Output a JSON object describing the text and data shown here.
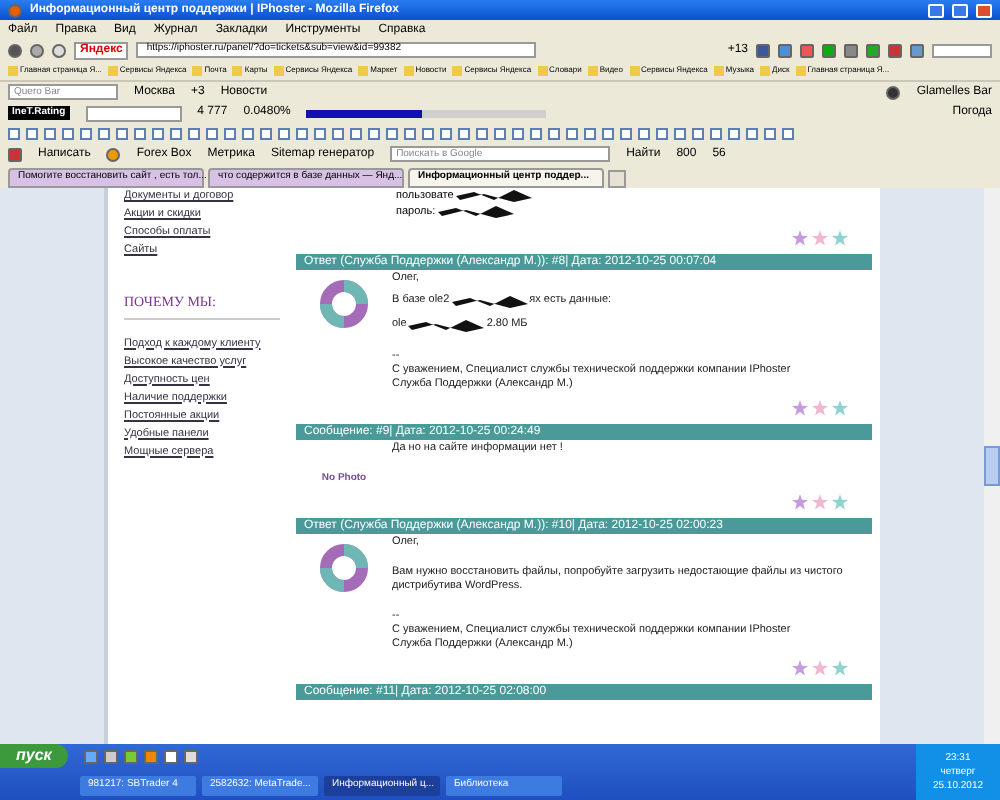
{
  "window": {
    "title": "Информационный центр поддержки | IPhoster - Mozilla Firefox"
  },
  "menu": [
    "Файл",
    "Правка",
    "Вид",
    "Журнал",
    "Закладки",
    "Инструменты",
    "Справка"
  ],
  "nav": {
    "brand": "Яндекс",
    "url": "https://iphoster.ru/panel/?do=tickets&sub=view&id=99382",
    "weather": "+13"
  },
  "bookmarks": [
    "Главная страница Я...",
    "Сервисы Яндекса",
    "Почта",
    "Карты",
    "Сервисы Яндекса",
    "Маркет",
    "Новости",
    "Сервисы Яндекса",
    "Словари",
    "Видео",
    "Сервисы Яндекса",
    "Музыка",
    "Диск",
    "Главная страница Я..."
  ],
  "yabar": {
    "placeholder": "Quero Bar",
    "city": "Москва",
    "temp": "+3",
    "news": "Новости",
    "right": "Glamelles Bar"
  },
  "stats": {
    "label": "IneT.Rating",
    "rank": "4 777",
    "percent": "0.0480%",
    "level": 0.48,
    "weather": "Погода"
  },
  "addons": {
    "write": "Написать",
    "forex": "Forex Box",
    "metrika": "Метрика",
    "sitemap": "Sitemap генератор",
    "placeholder": "Поискать в Google",
    "find": "Найти",
    "count1": "800",
    "count2": "56"
  },
  "tabs": [
    {
      "label": "Помогите восстановить сайт , есть тол...",
      "selected": false
    },
    {
      "label": "что содержится в базе данных — Янд...",
      "selected": false
    },
    {
      "label": "Информационный центр поддер...",
      "selected": true
    }
  ],
  "sidebar": {
    "links": [
      "Документы и договор",
      "Акции и скидки",
      "Способы оплаты",
      "Сайты"
    ],
    "heading": "ПОЧЕМУ МЫ:",
    "why": [
      "Подход к каждому клиенту",
      "Высокое качество услуг",
      "Доступность цен",
      "Наличие поддержки",
      "Постоянные акции",
      "Удобные панели",
      "Мощные сервера"
    ]
  },
  "top_lines": [
    "пользовате",
    "пароль:"
  ],
  "posts": [
    {
      "kind": "reply",
      "header": "Ответ (Служба Поддержки (Александр М.)): #8| Дата: 2012-10-25 00:07:04",
      "lines": [
        {
          "text": "Олег,"
        },
        {
          "text": "В базе ole2",
          "after": "ях есть данные:",
          "redacted": true
        },
        {
          "text": "ole",
          "after": "2.80 МБ",
          "redacted": true
        }
      ],
      "sign": [
        "--",
        "С уважением, Специалист службы технической поддержки компании IPhoster",
        "Служба Поддержки (Александр М.)"
      ]
    },
    {
      "kind": "message",
      "header": "Сообщение: #9| Дата: 2012-10-25 00:24:49",
      "lines": [
        {
          "text": "Да но на сайте информации нет !"
        }
      ],
      "photo": "No Photo"
    },
    {
      "kind": "reply",
      "header": "Ответ (Служба Поддержки (Александр М.)): #10| Дата: 2012-10-25 02:00:23",
      "lines": [
        {
          "text": "Олег,"
        },
        {
          "text": "Вам нужно восстановить файлы, попробуйте загрузить недостающие файлы из чистого дистрибутива WordPress."
        }
      ],
      "sign": [
        "--",
        "С уважением, Специалист службы технической поддержки компании IPhoster",
        "Служба Поддержки (Александр М.)"
      ]
    },
    {
      "kind": "header",
      "header": "Сообщение: #11| Дата: 2012-10-25 02:08:00"
    }
  ],
  "taskbar": {
    "start": "пуск",
    "items": [
      {
        "label": "981217: SBTrader 4",
        "selected": false
      },
      {
        "label": "2582632: MetaTrade...",
        "selected": false
      },
      {
        "label": "Информационный ц...",
        "selected": true
      },
      {
        "label": "Библиотека",
        "selected": false
      }
    ],
    "time": "23:31",
    "day": "четверг",
    "date": "25.10.2012"
  }
}
